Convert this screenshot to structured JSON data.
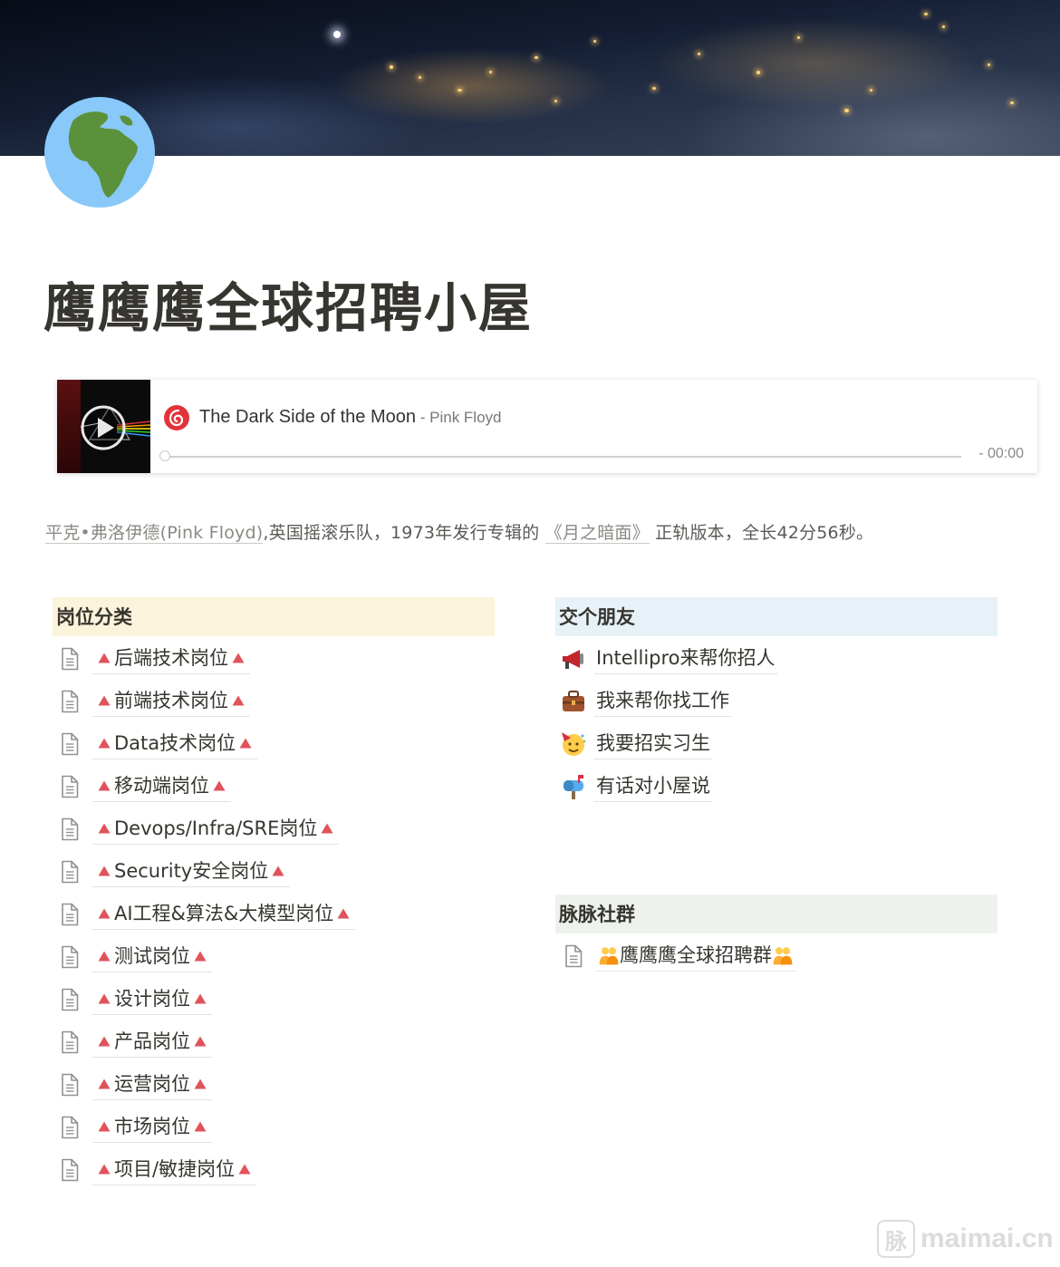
{
  "page": {
    "title": "鹰鹰鹰全球招聘小屋",
    "icon": "globe-africa-icon"
  },
  "player": {
    "track": "The Dark Side of the Moon",
    "separator": " - ",
    "artist": "Pink Floyd",
    "time": "- 00:00",
    "progress": 0,
    "logo": "netease-music-icon",
    "play_icon": "play-icon"
  },
  "description": {
    "link1": "平克•弗洛伊德(Pink Floyd)",
    "text1": ",英国摇滚乐队，1973年发行专辑的",
    "link2": "《月之暗面》",
    "text2": "正轨版本，全长42分56秒。"
  },
  "jobs": {
    "header": "岗位分类",
    "items": [
      {
        "label": "后端技术岗位"
      },
      {
        "label": "前端技术岗位"
      },
      {
        "label": "Data技术岗位"
      },
      {
        "label": "移动端岗位"
      },
      {
        "label": "Devops/Infra/SRE岗位"
      },
      {
        "label": "Security安全岗位"
      },
      {
        "label": "AI工程&算法&大模型岗位"
      },
      {
        "label": "测试岗位"
      },
      {
        "label": "设计岗位"
      },
      {
        "label": "产品岗位"
      },
      {
        "label": "运营岗位"
      },
      {
        "label": "市场岗位"
      },
      {
        "label": "项目/敏捷岗位"
      }
    ]
  },
  "friends": {
    "header": "交个朋友",
    "items": [
      {
        "label": "Intellipro来帮你招人",
        "icon": "megaphone-icon"
      },
      {
        "label": "我来帮你找工作",
        "icon": "briefcase-icon"
      },
      {
        "label": "我要招实习生",
        "icon": "party-face-icon"
      },
      {
        "label": "有话对小屋说",
        "icon": "mailbox-icon"
      }
    ]
  },
  "community": {
    "header": "脉脉社群",
    "items": [
      {
        "label": "鹰鹰鹰全球招聘群",
        "icon": "people-icon"
      }
    ]
  },
  "watermark": {
    "seal": "脉",
    "text": "maimai.cn"
  },
  "colors": {
    "accent_triangle": "#e0535b",
    "jobs_header_bg": "#fbf3db",
    "friends_header_bg": "#e7f1f8",
    "community_header_bg": "#edf3ec"
  }
}
